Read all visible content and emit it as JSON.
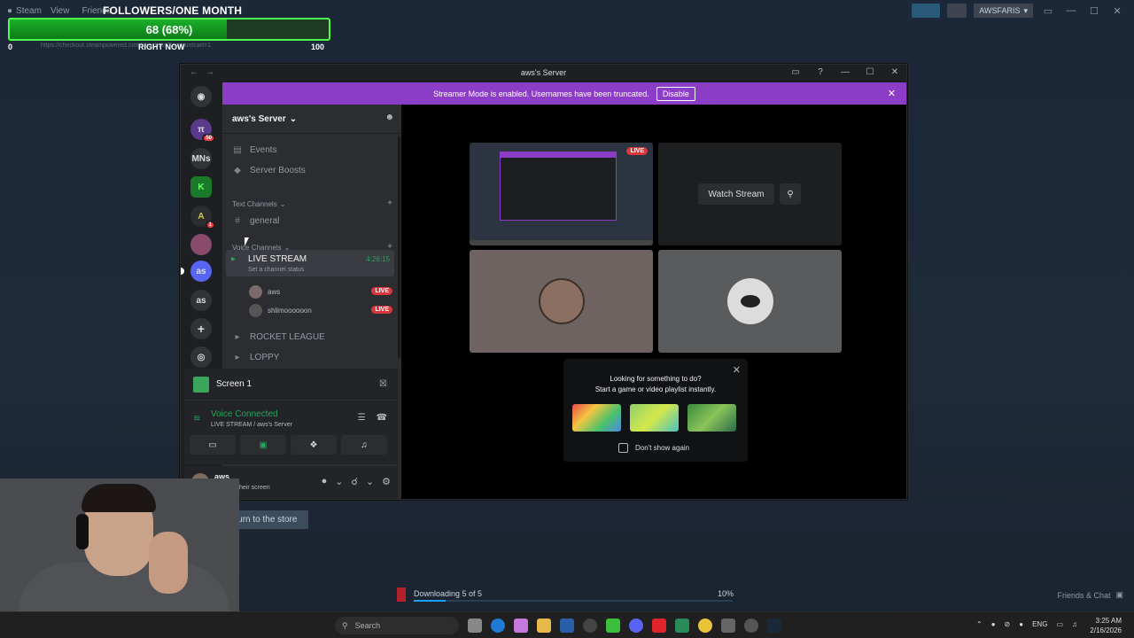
{
  "steam": {
    "logo_label": "Steam",
    "menu": [
      "View",
      "Friends"
    ],
    "username": "AWSFARIS",
    "url": "https://checkout.steampowered.com/checkout/?accountcart=1",
    "return_label": "Return to the store",
    "download_text": "Downloading 5 of 5",
    "download_percent": "10%",
    "download_progress": 0.1,
    "friends_chat": "Friends & Chat"
  },
  "overlay": {
    "title": "FOLLOWERS/ONE MONTH",
    "progress_text": "68 (68%)",
    "progress_value": 0.68,
    "min_label": "0",
    "now_label": "RIGHT NOW",
    "max_label": "100"
  },
  "discord": {
    "window_title": "aws's Server",
    "banner_text": "Streamer Mode is enabled. Usernames have been truncated.",
    "banner_button": "Disable",
    "server_name": "aws's Server",
    "servers": [
      {
        "label": "π",
        "badge": "50"
      },
      {
        "label": "MNs",
        "badge": ""
      },
      {
        "label": "K",
        "badge": ""
      },
      {
        "label": "A",
        "badge": "1"
      },
      {
        "label": "",
        "badge": ""
      },
      {
        "label": "as",
        "badge": ""
      },
      {
        "label": "as",
        "badge": ""
      }
    ],
    "nav": {
      "events": "Events",
      "boosts": "Server Boosts"
    },
    "text_category": "Text Channels",
    "text_channel": "general",
    "voice_category": "Voice Channels",
    "live_channel": "LIVE STREAM",
    "live_time": "4:26:15",
    "channel_status": "Set a channel status",
    "members": [
      {
        "name": "aws",
        "badge": "LIVE"
      },
      {
        "name": "shlimoooooon",
        "badge": "LIVE"
      }
    ],
    "voice_channels": [
      "ROCKET LEAGUE",
      "LOPPY"
    ],
    "screen_label": "Screen 1",
    "voice_connected": "Voice Connected",
    "voice_sub": "LIVE STREAM / aws's Server",
    "user_name": "aws",
    "user_status": "Sharing their screen",
    "stage": {
      "live_badge": "LIVE",
      "watch_label": "Watch Stream",
      "activity_line1": "Looking for something to do?",
      "activity_line2": "Start a game or video playlist instantly.",
      "dont_show": "Don't show again"
    }
  },
  "taskbar": {
    "search_placeholder": "Search",
    "lang": "ENG",
    "time": "3:25 AM",
    "date": "2/16/2026"
  }
}
